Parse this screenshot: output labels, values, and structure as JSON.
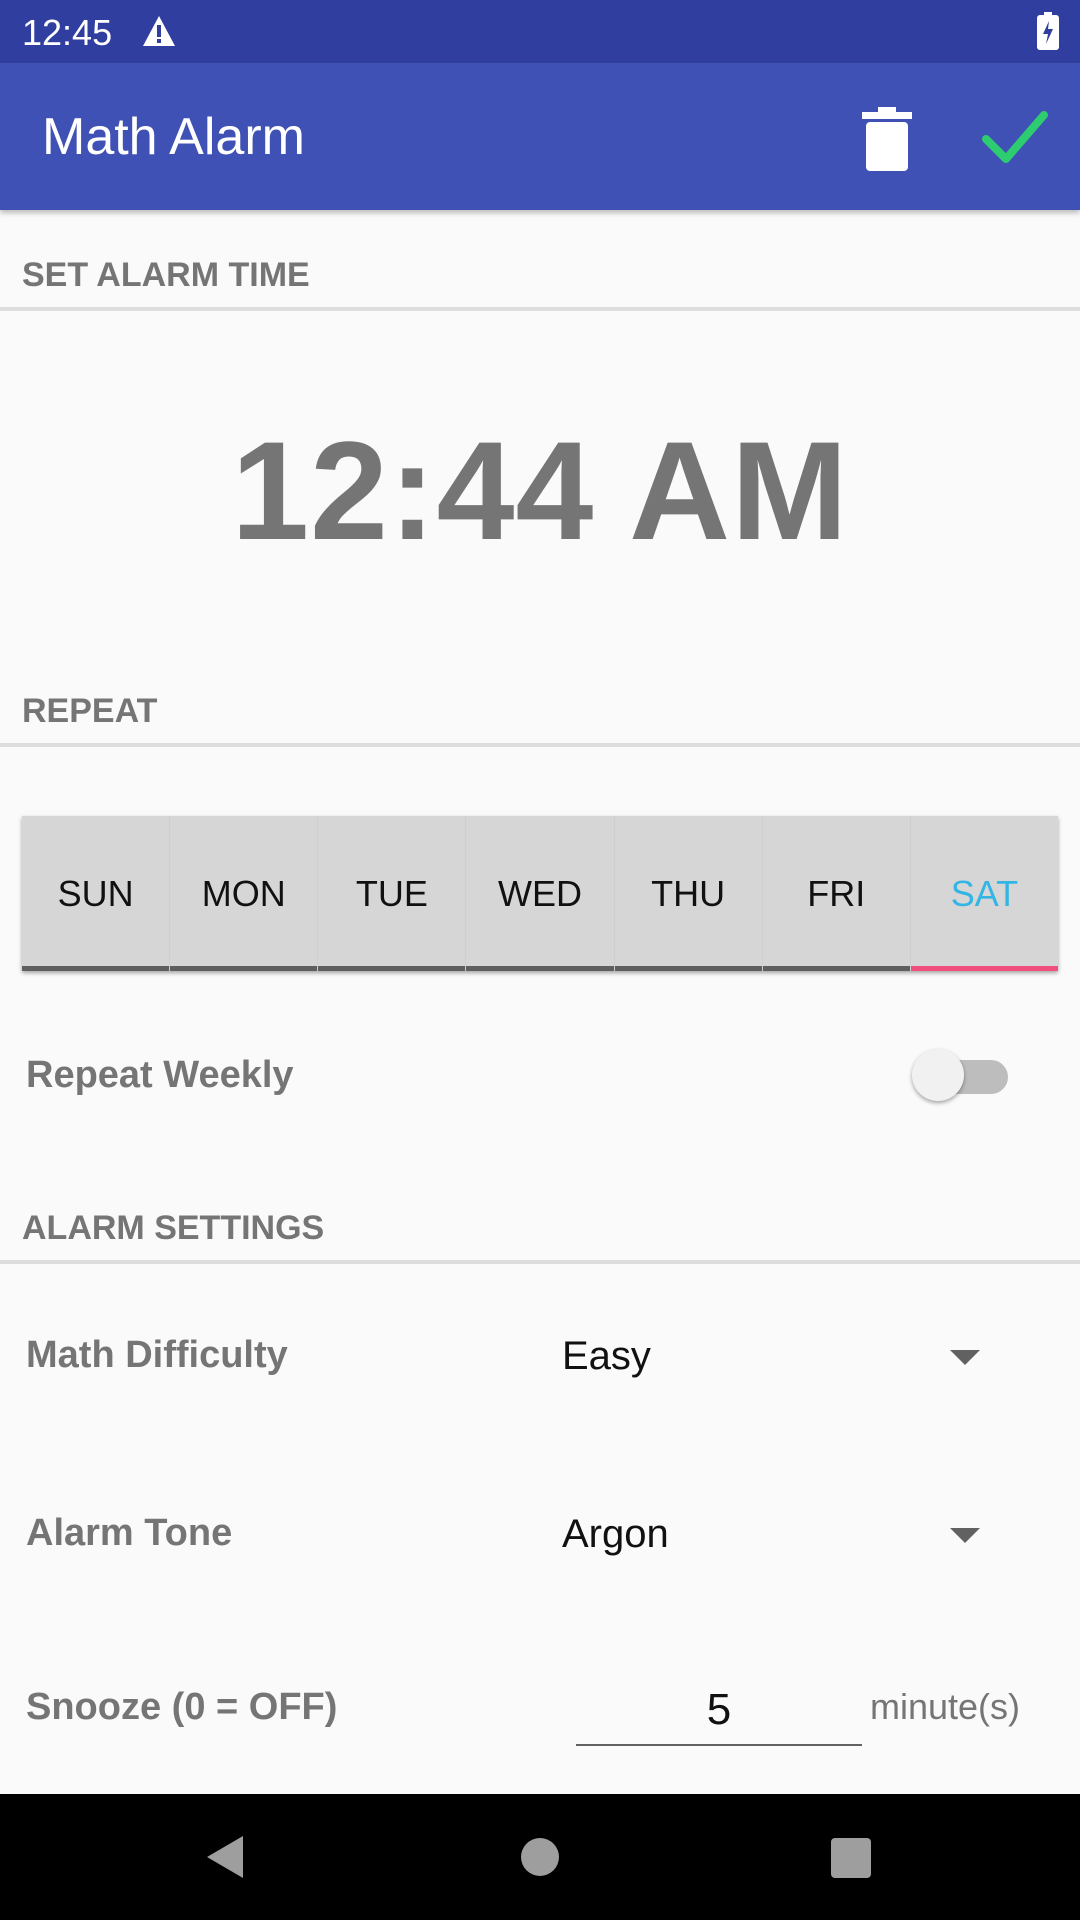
{
  "status_bar": {
    "time": "12:45",
    "icons": [
      "warning-icon",
      "battery-charging-icon"
    ]
  },
  "app_bar": {
    "title": "Math Alarm",
    "actions": [
      "delete-icon",
      "check-icon"
    ],
    "check_color": "#2ecc71"
  },
  "sections": {
    "set_alarm_time": "SET ALARM TIME",
    "repeat": "REPEAT",
    "alarm_settings": "ALARM SETTINGS"
  },
  "alarm": {
    "time": "12:44 AM"
  },
  "days": {
    "items": [
      {
        "label": "SUN",
        "selected": false
      },
      {
        "label": "MON",
        "selected": false
      },
      {
        "label": "TUE",
        "selected": false
      },
      {
        "label": "WED",
        "selected": false
      },
      {
        "label": "THU",
        "selected": false
      },
      {
        "label": "FRI",
        "selected": false
      },
      {
        "label": "SAT",
        "selected": true
      }
    ],
    "selected_text_color": "#33b5e5",
    "selected_underline_color": "#f04e7c"
  },
  "repeat_weekly": {
    "label": "Repeat Weekly",
    "enabled": false
  },
  "settings": {
    "math_difficulty": {
      "label": "Math Difficulty",
      "value": "Easy"
    },
    "alarm_tone": {
      "label": "Alarm Tone",
      "value": "Argon"
    },
    "snooze": {
      "label": "Snooze (0 = OFF)",
      "value": "5",
      "unit": "minute(s)"
    }
  },
  "nav_bar": {
    "buttons": [
      "back-icon",
      "home-icon",
      "recents-icon"
    ]
  },
  "colors": {
    "status_bar": "#303f9f",
    "app_bar": "#3f51b5",
    "background": "#fafafa"
  }
}
